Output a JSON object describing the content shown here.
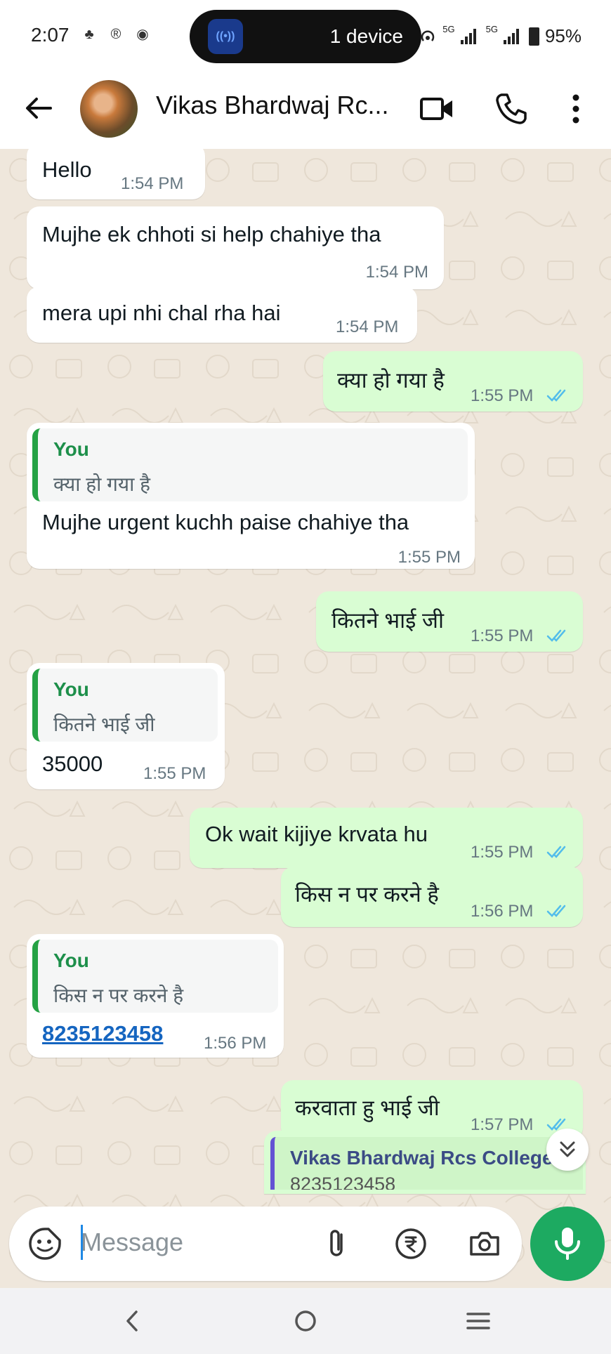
{
  "status_bar": {
    "time": "2:07",
    "pill_label": "1 device",
    "pill_icon_text": "((•))",
    "network_1": "5G",
    "network_2": "5G",
    "battery": "95%"
  },
  "header": {
    "contact_name": "Vikas Bhardwaj Rc...",
    "icons": [
      "back-arrow-icon",
      "video-call-icon",
      "voice-call-icon",
      "more-options-icon"
    ]
  },
  "messages": [
    {
      "dir": "in",
      "text": "Hello",
      "time": "1:54 PM"
    },
    {
      "dir": "in",
      "text": "Mujhe ek chhoti si help chahiye tha",
      "time": "1:54 PM"
    },
    {
      "dir": "in",
      "text": "mera upi nhi chal rha hai",
      "time": "1:54 PM"
    },
    {
      "dir": "out",
      "text": "क्या हो गया है",
      "time": "1:55 PM"
    },
    {
      "dir": "in",
      "quote_author": "You",
      "quote_text": "क्या हो गया है",
      "text": "Mujhe urgent kuchh paise chahiye tha",
      "time": "1:55 PM"
    },
    {
      "dir": "out",
      "text": "कितने भाई जी",
      "time": "1:55 PM"
    },
    {
      "dir": "in",
      "quote_author": "You",
      "quote_text": "कितने भाई जी",
      "text": "35000",
      "time": "1:55 PM"
    },
    {
      "dir": "out",
      "text": "Ok wait kijiye krvata hu",
      "time": "1:55 PM"
    },
    {
      "dir": "out",
      "text": "किस न पर करने है",
      "time": "1:56 PM"
    },
    {
      "dir": "in",
      "quote_author": "You",
      "quote_text": "किस न पर करने है",
      "text": "8235123458",
      "time": "1:56 PM"
    },
    {
      "dir": "out",
      "text": "करवाता हु भाई जी",
      "time": "1:57 PM"
    }
  ],
  "contact_card": {
    "name": "Vikas Bhardwaj Rcs College",
    "number": "8235123458"
  },
  "composer": {
    "placeholder": "Message",
    "icons": [
      "sticker-icon",
      "attach-icon",
      "rupee-payment-icon",
      "camera-icon"
    ],
    "send_icon": "mic-icon"
  },
  "colors": {
    "chat_bg": "#efe7dc",
    "incoming": "#ffffff",
    "outgoing": "#d9fdd3",
    "accent_green": "#1daa61",
    "quote_bar": "#25a244",
    "link": "#1565c0"
  }
}
